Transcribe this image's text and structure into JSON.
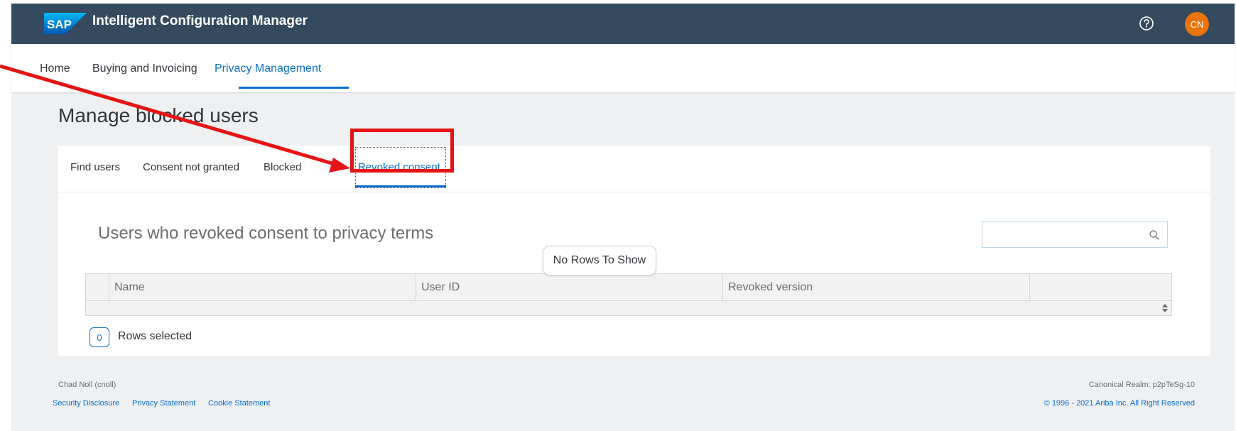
{
  "shellbar": {
    "logo_text": "SAP",
    "title": "Intelligent Configuration Manager",
    "help_icon": "help-icon",
    "avatar_initials": "CN",
    "avatar_color": "#e9730c",
    "background_color": "#354a5f"
  },
  "topnav": {
    "items": [
      {
        "label": "Home"
      },
      {
        "label": "Buying and Invoicing"
      },
      {
        "label": "Privacy Management"
      }
    ],
    "active_index": 2
  },
  "page": {
    "title": "Manage blocked users"
  },
  "tabs": {
    "items": [
      {
        "label": "Find users"
      },
      {
        "label": "Consent not granted"
      },
      {
        "label": "Blocked"
      },
      {
        "label": "Revoked consent"
      }
    ],
    "active_index": 3
  },
  "section": {
    "title": "Users who revoked consent to privacy terms",
    "search_placeholder": "",
    "search_icon": "search-icon"
  },
  "table": {
    "columns": [
      "Name",
      "User ID",
      "Revoked version"
    ],
    "rows": [],
    "overlay_text": "No Rows To Show"
  },
  "selection": {
    "count": "0",
    "label": "Rows selected"
  },
  "footer": {
    "user": "Chad Noll (cnoll)",
    "links": [
      "Security Disclosure",
      "Privacy Statement",
      "Cookie Statement"
    ],
    "realm": "Canonical Realm: p2pTeSg-10",
    "copyright": "© 1996 - 2021 Ariba Inc. All Right Reserved"
  },
  "colors": {
    "accent": "#0a6ed1",
    "annotation": "#e51414"
  }
}
